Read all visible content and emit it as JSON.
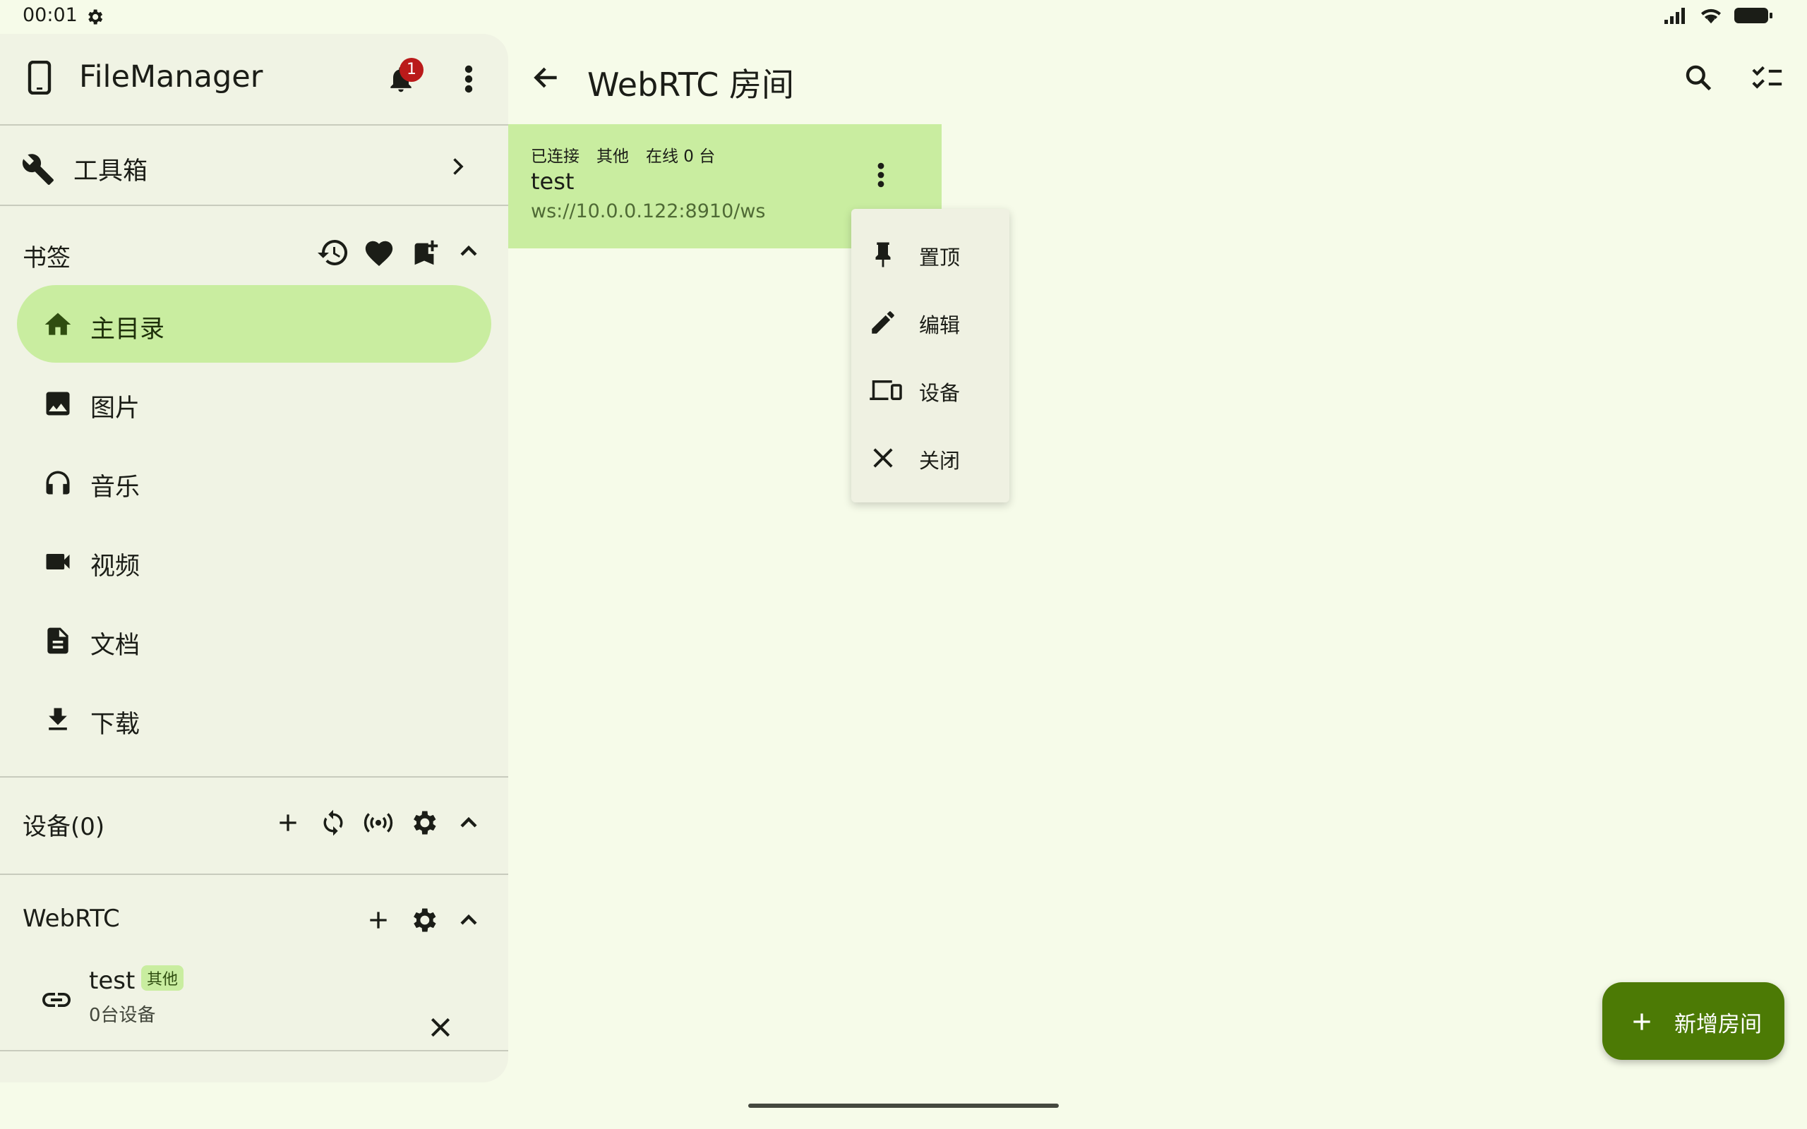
{
  "status_bar": {
    "time": "00:01"
  },
  "drawer": {
    "app_title": "FileManager",
    "notification_count": "1",
    "toolbox_label": "工具箱",
    "bookmarks_title": "书签",
    "nav_items": [
      {
        "label": "主目录",
        "icon": "home-icon",
        "active": true
      },
      {
        "label": "图片",
        "icon": "image-icon"
      },
      {
        "label": "音乐",
        "icon": "headphones-icon"
      },
      {
        "label": "视频",
        "icon": "video-icon"
      },
      {
        "label": "文档",
        "icon": "document-icon"
      },
      {
        "label": "下载",
        "icon": "download-icon"
      }
    ],
    "devices_title": "设备(0)",
    "webrtc_title": "WebRTC",
    "room": {
      "name": "test",
      "tag": "其他",
      "devices": "0台设备"
    }
  },
  "main": {
    "title": "WebRTC 房间",
    "card": {
      "status": "已连接",
      "type": "其他",
      "online": "在线 0 台",
      "name": "test",
      "url": "ws://10.0.0.122:8910/ws"
    },
    "menu": [
      {
        "label": "置顶",
        "icon": "pin-icon"
      },
      {
        "label": "编辑",
        "icon": "edit-icon"
      },
      {
        "label": "设备",
        "icon": "devices-icon"
      },
      {
        "label": "关闭",
        "icon": "close-icon"
      }
    ],
    "fab_label": "新增房间"
  },
  "colors": {
    "background": "#f6fbe9",
    "drawer_bg": "#f0f3e4",
    "accent_container": "#c9eda0",
    "primary": "#4c7a05",
    "badge": "#ba1a1a"
  }
}
